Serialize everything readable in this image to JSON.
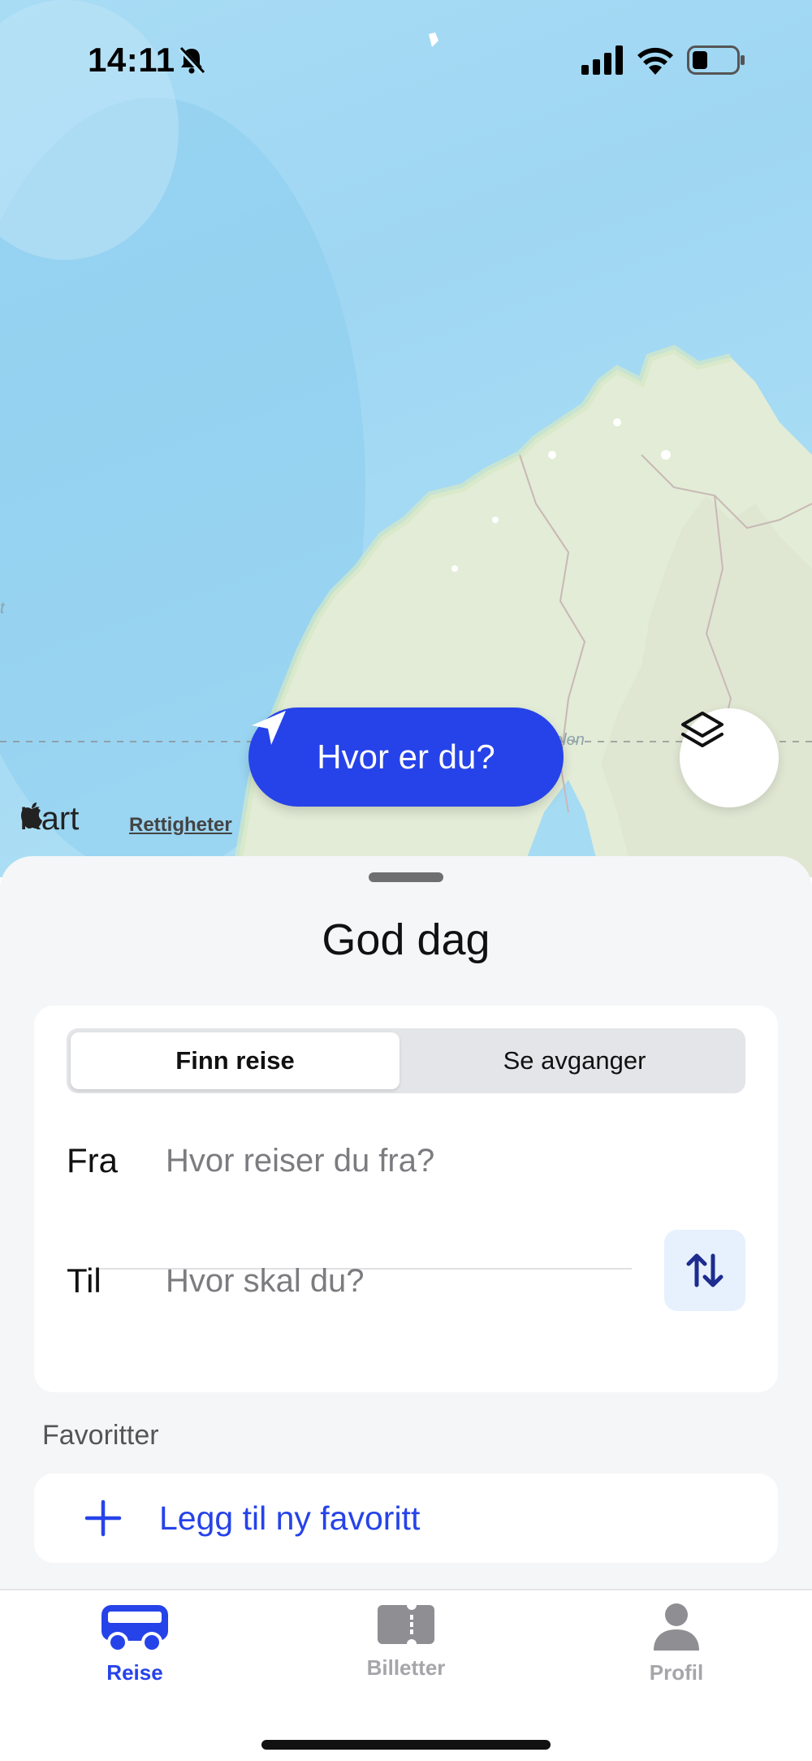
{
  "status_bar": {
    "time": "14:11"
  },
  "map": {
    "locate_button_label": "Hvor er du?",
    "provider_label": "Kart",
    "rights_link": "Rettigheter",
    "place_label_partial": "elen",
    "edge_label_partial": "t"
  },
  "sheet": {
    "greeting": "God dag",
    "segment": {
      "options": [
        "Finn reise",
        "Se avganger"
      ],
      "selected": "Finn reise"
    },
    "from": {
      "label": "Fra",
      "placeholder": "Hvor reiser du fra?",
      "value": ""
    },
    "to": {
      "label": "Til",
      "placeholder": "Hvor skal du?",
      "value": ""
    },
    "favorites": {
      "heading": "Favoritter",
      "add_label": "Legg til ny favoritt"
    }
  },
  "tabbar": {
    "tabs": [
      {
        "label": "Reise",
        "icon": "bus-icon",
        "active": true
      },
      {
        "label": "Billetter",
        "icon": "ticket-icon",
        "active": false
      },
      {
        "label": "Profil",
        "icon": "person-icon",
        "active": false
      }
    ]
  },
  "colors": {
    "accent": "#2643e9",
    "swap_bg": "#e6f1fd",
    "sheet_bg": "#f4f6f7"
  }
}
